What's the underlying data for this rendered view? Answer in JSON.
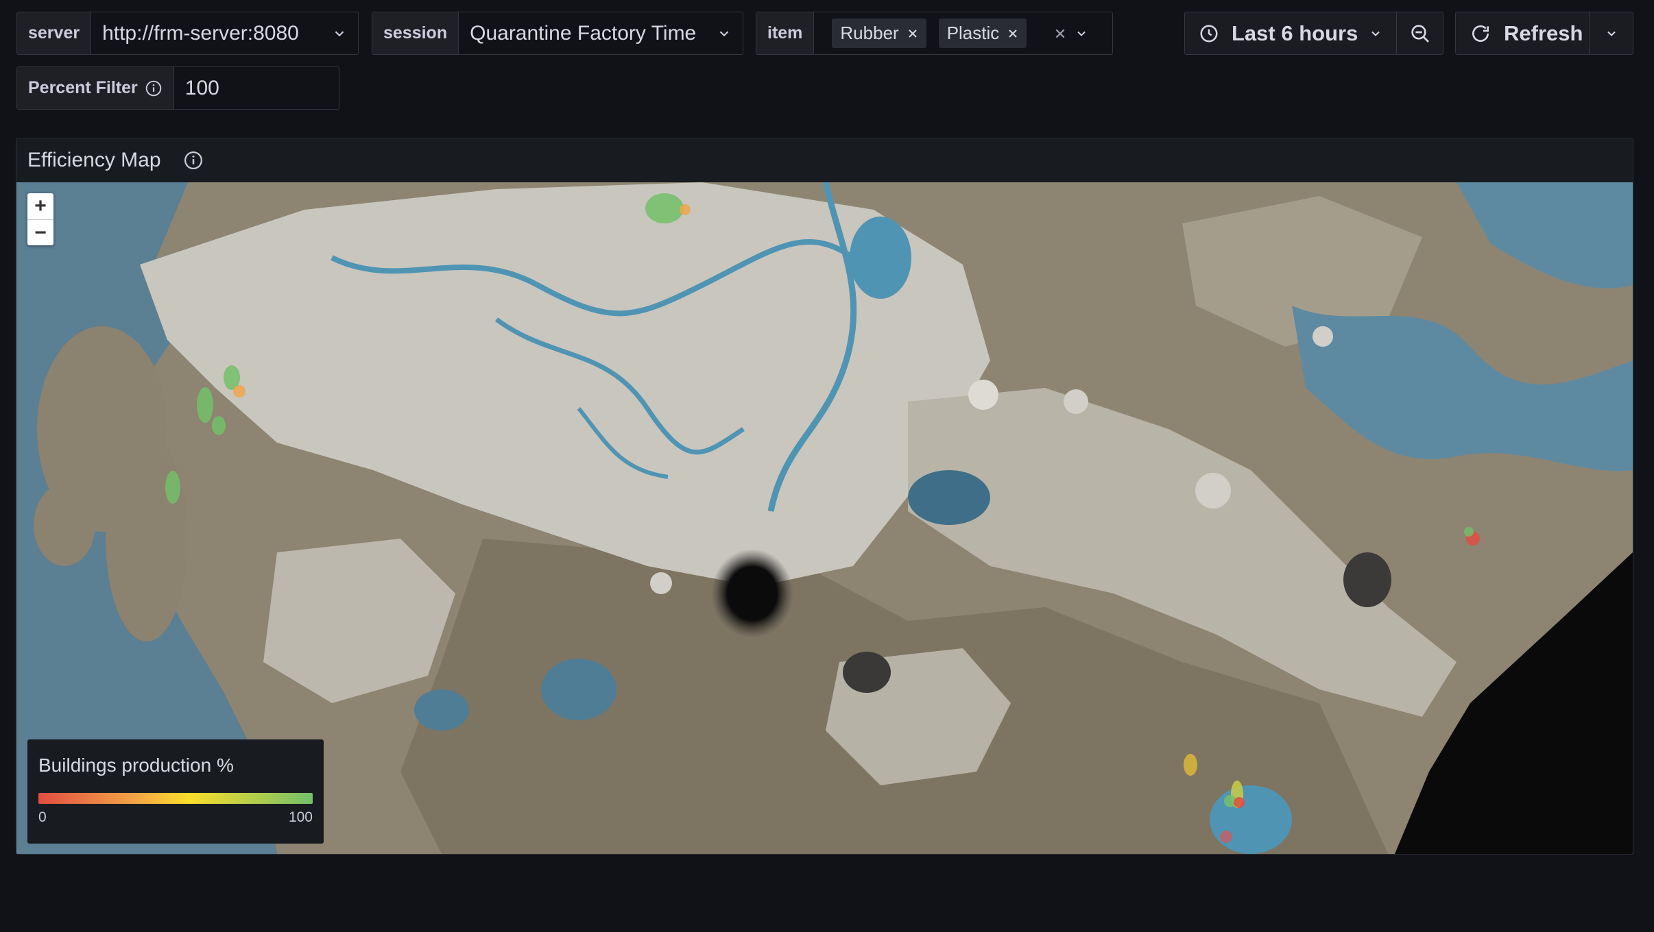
{
  "variables": {
    "server": {
      "label": "server",
      "value": "http://frm-server:8080"
    },
    "session": {
      "label": "session",
      "value": "Quarantine Factory Time"
    },
    "item": {
      "label": "item",
      "chips": [
        "Rubber",
        "Plastic"
      ]
    },
    "percent_filter": {
      "label": "Percent Filter",
      "value": "100"
    }
  },
  "toolbar": {
    "time_range": "Last 6 hours",
    "refresh_label": "Refresh"
  },
  "panel": {
    "title": "Efficiency Map",
    "legend": {
      "title": "Buildings production %",
      "min": "0",
      "max": "100"
    },
    "zoom_in": "+",
    "zoom_out": "−"
  },
  "colors": {
    "background": "#111217",
    "panel": "#181b1f",
    "efficiency_low": "#e24d42",
    "efficiency_mid": "#fade2a",
    "efficiency_high": "#73bf69"
  }
}
